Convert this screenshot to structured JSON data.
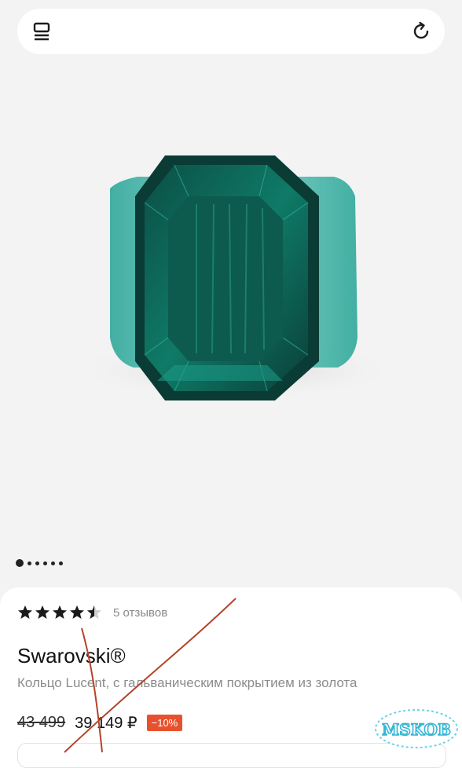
{
  "topbar": {
    "menu_icon": "catalog-icon",
    "refresh_icon": "refresh-icon"
  },
  "gallery": {
    "image_alt_icon": "emerald-ring-image",
    "dots_total": 6,
    "dots_active": 1
  },
  "product": {
    "rating": 4.5,
    "reviews": "5 отзывов",
    "brand": "Swarovski®",
    "title": "Кольцо Lucent, с гальваническим покрытием из золота",
    "old_price": "43 499",
    "price": "39 149 ₽",
    "discount": "−10%"
  },
  "watermark": {
    "text": "MSKOB"
  },
  "colors": {
    "accent_discount": "#e8512d",
    "gem": "#0f6e5e",
    "scribble": "#b4432a"
  }
}
